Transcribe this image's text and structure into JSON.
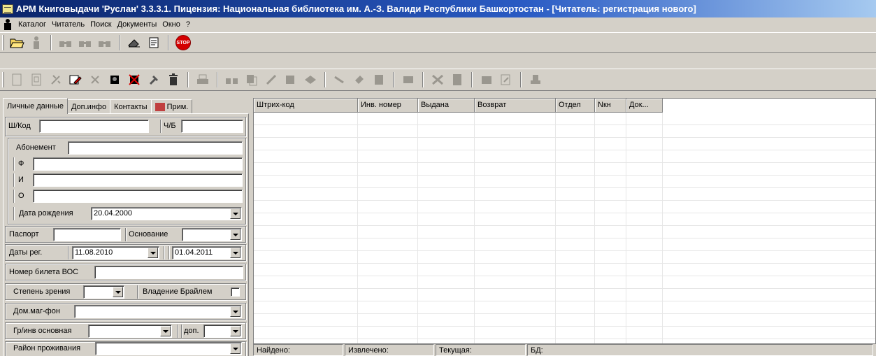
{
  "window": {
    "title": "АРМ Книговыдачи 'Руслан' 3.3.3.1. Пицензия:  Национальная библиотека им. А.-З. Валиди Республики Башкортостан - [Читатель: регистрация нового]"
  },
  "menu": [
    "Каталог",
    "Читатель",
    "Поиск",
    "Документы",
    "Окно",
    "?"
  ],
  "tabs": [
    "Личные данные",
    "Доп.инфо",
    "Контакты",
    "Прим."
  ],
  "form": {
    "shk_label": "Ш/Код",
    "shk_value": "",
    "chb_label": "Ч/Б",
    "chb_value": "",
    "abonement_label": "Абонемент",
    "abonement_value": "",
    "f_label": "Ф",
    "f_value": "",
    "i_label": "И",
    "i_value": "",
    "o_label": "О",
    "o_value": "",
    "dob_label": "Дата рождения",
    "dob_value": "20.04.2000",
    "passport_label": "Паспорт",
    "passport_value": "",
    "osnovanie_label": "Основание",
    "osnovanie_value": "",
    "reg_label": "Даты рег.",
    "reg_from": "11.08.2010",
    "reg_to": "01.04.2011",
    "vos_label": "Номер билета ВОС",
    "vos_value": "",
    "vision_label": "Степень зрения",
    "vision_value": "",
    "braille_label": "Владение Брайлем",
    "phone_label": "Дом.маг-фон",
    "phone_value": "",
    "group_label": "Гр/инв основная",
    "group_value": "",
    "dop_label": "доп.",
    "dop_value": "",
    "district_label": "Район проживания",
    "district_value": ""
  },
  "grid": {
    "columns": [
      "Штрих-код",
      "Инв. номер",
      "Выдана",
      "Возврат",
      "Отдел",
      "Nкн",
      "Док..."
    ]
  },
  "status": [
    "Найдено:",
    "Извлечено:",
    "Текущая:",
    "БД:"
  ]
}
